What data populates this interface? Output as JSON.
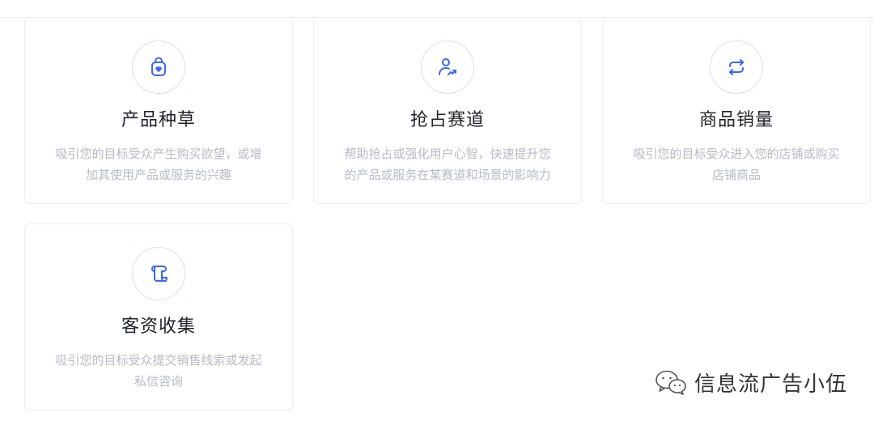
{
  "cards": [
    {
      "title": "产品种草",
      "desc_line1": "吸引您的目标受众产生购买欲望，或增",
      "desc_line2": "加其使用产品或服务的兴趣",
      "icon": "shopping-bag-heart-icon"
    },
    {
      "title": "抢占赛道",
      "desc_line1": "帮助抢占或强化用户心智，快速提升您",
      "desc_line2": "的产品或服务在某赛道和场景的影响力",
      "icon": "user-trend-icon"
    },
    {
      "title": "商品销量",
      "desc_line1": "吸引您的目标受众进入您的店铺或购买",
      "desc_line2": "店铺商品",
      "icon": "refresh-cycle-icon"
    },
    {
      "title": "客资收集",
      "desc_line1": "吸引您的目标受众提交销售线索或发起",
      "desc_line2": "私信咨询",
      "icon": "scroll-icon"
    }
  ],
  "watermark": {
    "text": "信息流广告小伍",
    "icon": "wechat-logo-icon"
  },
  "colors": {
    "accent": "#3b66f5",
    "icon_ring": "#d9defc",
    "title": "#1f2329",
    "desc": "#b7bbc3",
    "card_border": "#eceef2"
  }
}
